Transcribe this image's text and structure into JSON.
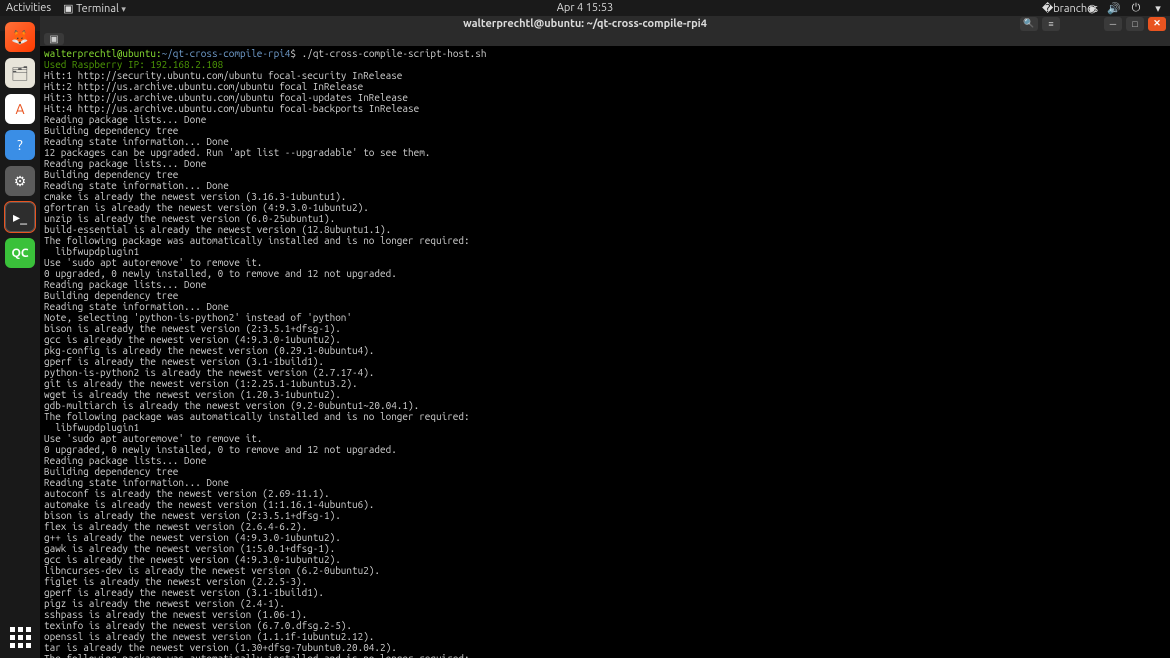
{
  "topbar": {
    "activities": "Activities",
    "terminal": "Terminal",
    "datetime": "Apr 4  15:53"
  },
  "window": {
    "title": "walterprechtl@ubuntu: ~/qt-cross-compile-rpi4"
  },
  "prompt": {
    "userhost": "walterprechtl@ubuntu:",
    "path": "~/qt-cross-compile-rpi4",
    "dollar": "$ ",
    "command": "./qt-cross-compile-script-host.sh"
  },
  "usedip": "Used Raspberry IP: 192.168.2.108",
  "output": "Hit:1 http://security.ubuntu.com/ubuntu focal-security InRelease\nHit:2 http://us.archive.ubuntu.com/ubuntu focal InRelease\nHit:3 http://us.archive.ubuntu.com/ubuntu focal-updates InRelease\nHit:4 http://us.archive.ubuntu.com/ubuntu focal-backports InRelease\nReading package lists... Done\nBuilding dependency tree\nReading state information... Done\n12 packages can be upgraded. Run 'apt list --upgradable' to see them.\nReading package lists... Done\nBuilding dependency tree\nReading state information... Done\ncmake is already the newest version (3.16.3-1ubuntu1).\ngfortran is already the newest version (4:9.3.0-1ubuntu2).\nunzip is already the newest version (6.0-25ubuntu1).\nbuild-essential is already the newest version (12.8ubuntu1.1).\nThe following package was automatically installed and is no longer required:\n  libfwupdplugin1\nUse 'sudo apt autoremove' to remove it.\n0 upgraded, 0 newly installed, 0 to remove and 12 not upgraded.\nReading package lists... Done\nBuilding dependency tree\nReading state information... Done\nNote, selecting 'python-is-python2' instead of 'python'\nbison is already the newest version (2:3.5.1+dfsg-1).\ngcc is already the newest version (4:9.3.0-1ubuntu2).\npkg-config is already the newest version (0.29.1-0ubuntu4).\ngperf is already the newest version (3.1-1build1).\npython-is-python2 is already the newest version (2.7.17-4).\ngit is already the newest version (1:2.25.1-1ubuntu3.2).\nwget is already the newest version (1.20.3-1ubuntu2).\ngdb-multiarch is already the newest version (9.2-0ubuntu1~20.04.1).\nThe following package was automatically installed and is no longer required:\n  libfwupdplugin1\nUse 'sudo apt autoremove' to remove it.\n0 upgraded, 0 newly installed, 0 to remove and 12 not upgraded.\nReading package lists... Done\nBuilding dependency tree\nReading state information... Done\nautoconf is already the newest version (2.69-11.1).\nautomake is already the newest version (1:1.16.1-4ubuntu6).\nbison is already the newest version (2:3.5.1+dfsg-1).\nflex is already the newest version (2.6.4-6.2).\ng++ is already the newest version (4:9.3.0-1ubuntu2).\ngawk is already the newest version (1:5.0.1+dfsg-1).\ngcc is already the newest version (4:9.3.0-1ubuntu2).\nlibncurses-dev is already the newest version (6.2-0ubuntu2).\nfiglet is already the newest version (2.2.5-3).\ngperf is already the newest version (3.1-1build1).\npigz is already the newest version (2.4-1).\nsshpass is already the newest version (1.06-1).\ntexinfo is already the newest version (6.7.0.dfsg.2-5).\nopenssl is already the newest version (1.1.1f-1ubuntu2.12).\ntar is already the newest version (1.30+dfsg-7ubuntu0.20.04.2).\nThe following package was automatically installed and is no longer required:",
  "dock": {
    "qc_label": "QC"
  }
}
